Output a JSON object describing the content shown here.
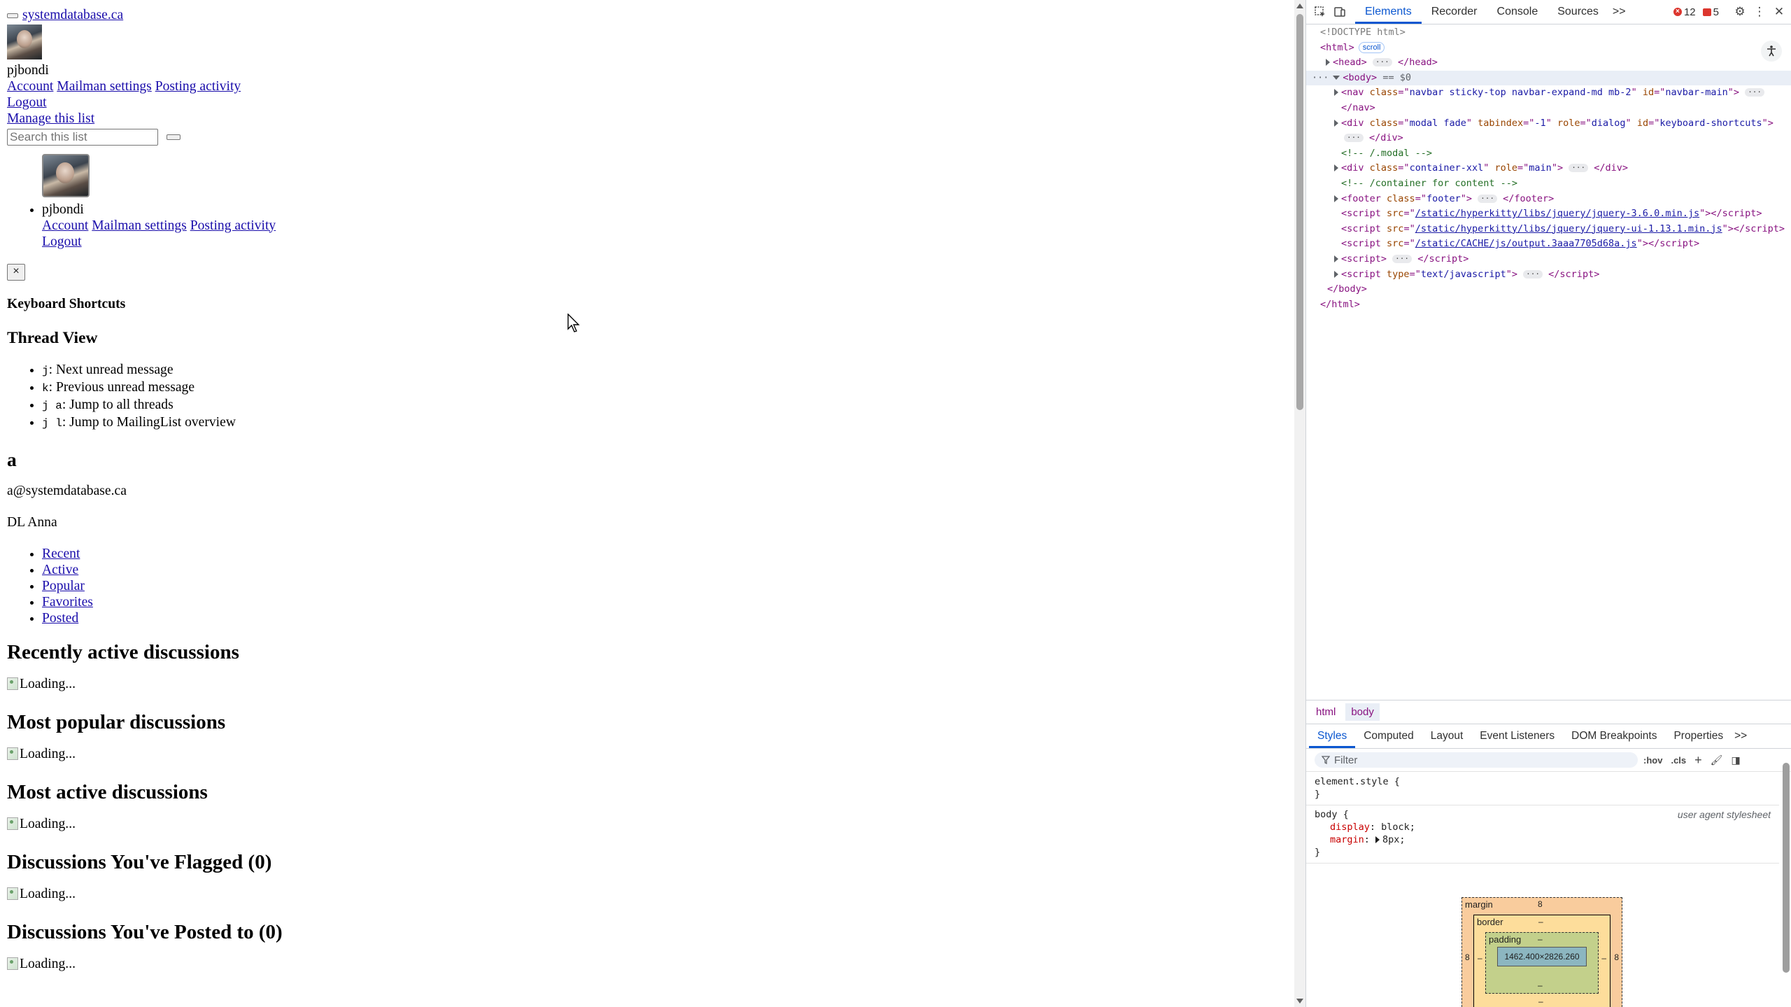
{
  "page": {
    "site_link": "systemdatabase.ca",
    "username": "pjbondi",
    "account_links": [
      "Account",
      "Mailman settings",
      "Posting activity"
    ],
    "logout": "Logout",
    "manage_list": "Manage this list",
    "search_placeholder": "Search this list",
    "dropdown_username": "pjbondi",
    "close_glyph": "×",
    "keyboard_shortcuts_title": "Keyboard Shortcuts",
    "thread_view_title": "Thread View",
    "shortcuts": [
      {
        "key": "j",
        "desc": ": Next unread message"
      },
      {
        "key": "k",
        "desc": ": Previous unread message"
      },
      {
        "key": "j a",
        "desc": ": Jump to all threads"
      },
      {
        "key": "j l",
        "desc": ": Jump to MailingList overview"
      }
    ],
    "list_name": "a",
    "list_email": "a@systemdatabase.ca",
    "list_description": "DL Anna",
    "nav_links": [
      "Recent",
      "Active",
      "Popular",
      "Favorites",
      "Posted"
    ],
    "sections": [
      {
        "title": "Recently active discussions",
        "loading": "Loading..."
      },
      {
        "title": "Most popular discussions",
        "loading": "Loading..."
      },
      {
        "title": "Most active discussions",
        "loading": "Loading..."
      },
      {
        "title": "Discussions You've Flagged (0)",
        "loading": "Loading..."
      },
      {
        "title": "Discussions You've Posted to (0)",
        "loading": "Loading..."
      }
    ]
  },
  "devtools": {
    "tabs": [
      "Elements",
      "Recorder",
      "Console",
      "Sources"
    ],
    "active_tab": "Elements",
    "more_tabs": ">>",
    "error_count": "12",
    "message_count": "5",
    "dom": {
      "doctype": "<!DOCTYPE html>",
      "html_open": "<html>",
      "scroll_badge": "scroll",
      "head": "<head>",
      "head_close": "</head>",
      "body_open": "<body>",
      "body_marker": "== $0",
      "nav_tag": "nav",
      "nav_attrs": [
        {
          "name": "class",
          "value": "navbar sticky-top navbar-expand-md mb-2"
        },
        {
          "name": "id",
          "value": "navbar-main"
        }
      ],
      "nav_close": "</nav>",
      "modal_attrs": [
        {
          "name": "class",
          "value": "modal fade"
        },
        {
          "name": "tabindex",
          "value": "-1"
        },
        {
          "name": "role",
          "value": "dialog"
        },
        {
          "name": "id",
          "value": "keyboard-shortcuts"
        }
      ],
      "div_close": "</div>",
      "comment_modal": "<!-- /.modal -->",
      "container_attrs": [
        {
          "name": "class",
          "value": "container-xxl"
        },
        {
          "name": "role",
          "value": "main"
        }
      ],
      "comment_container": "<!-- /container for content -->",
      "footer_attrs": [
        {
          "name": "class",
          "value": "footer"
        }
      ],
      "footer_close": "</footer>",
      "scripts": [
        "/static/hyperkitty/libs/jquery/jquery-3.6.0.min.js",
        "/static/hyperkitty/libs/jquery/jquery-ui-1.13.1.min.js",
        "/static/CACHE/js/output.3aaa7705d68a.js"
      ],
      "script_type": "text/javascript",
      "body_close": "</body>",
      "html_close": "</html>"
    },
    "breadcrumbs": [
      "html",
      "body"
    ],
    "sub_tabs": [
      "Styles",
      "Computed",
      "Layout",
      "Event Listeners",
      "DOM Breakpoints",
      "Properties"
    ],
    "filter_placeholder": "Filter",
    "hov": ":hov",
    ".cls": ".cls",
    "element_style_selector": "element.style {",
    "body_selector": "body {",
    "user_agent_label": "user agent stylesheet",
    "body_props": [
      {
        "name": "display",
        "value": "block;"
      },
      {
        "name": "margin",
        "value": "8px;"
      }
    ],
    "close_brace": "}",
    "box_model": {
      "margin_label": "margin",
      "margin_value": "8",
      "border_label": "border",
      "border_value": "–",
      "padding_label": "padding",
      "padding_value": "–",
      "content_size": "1462.400×2826.260"
    }
  }
}
